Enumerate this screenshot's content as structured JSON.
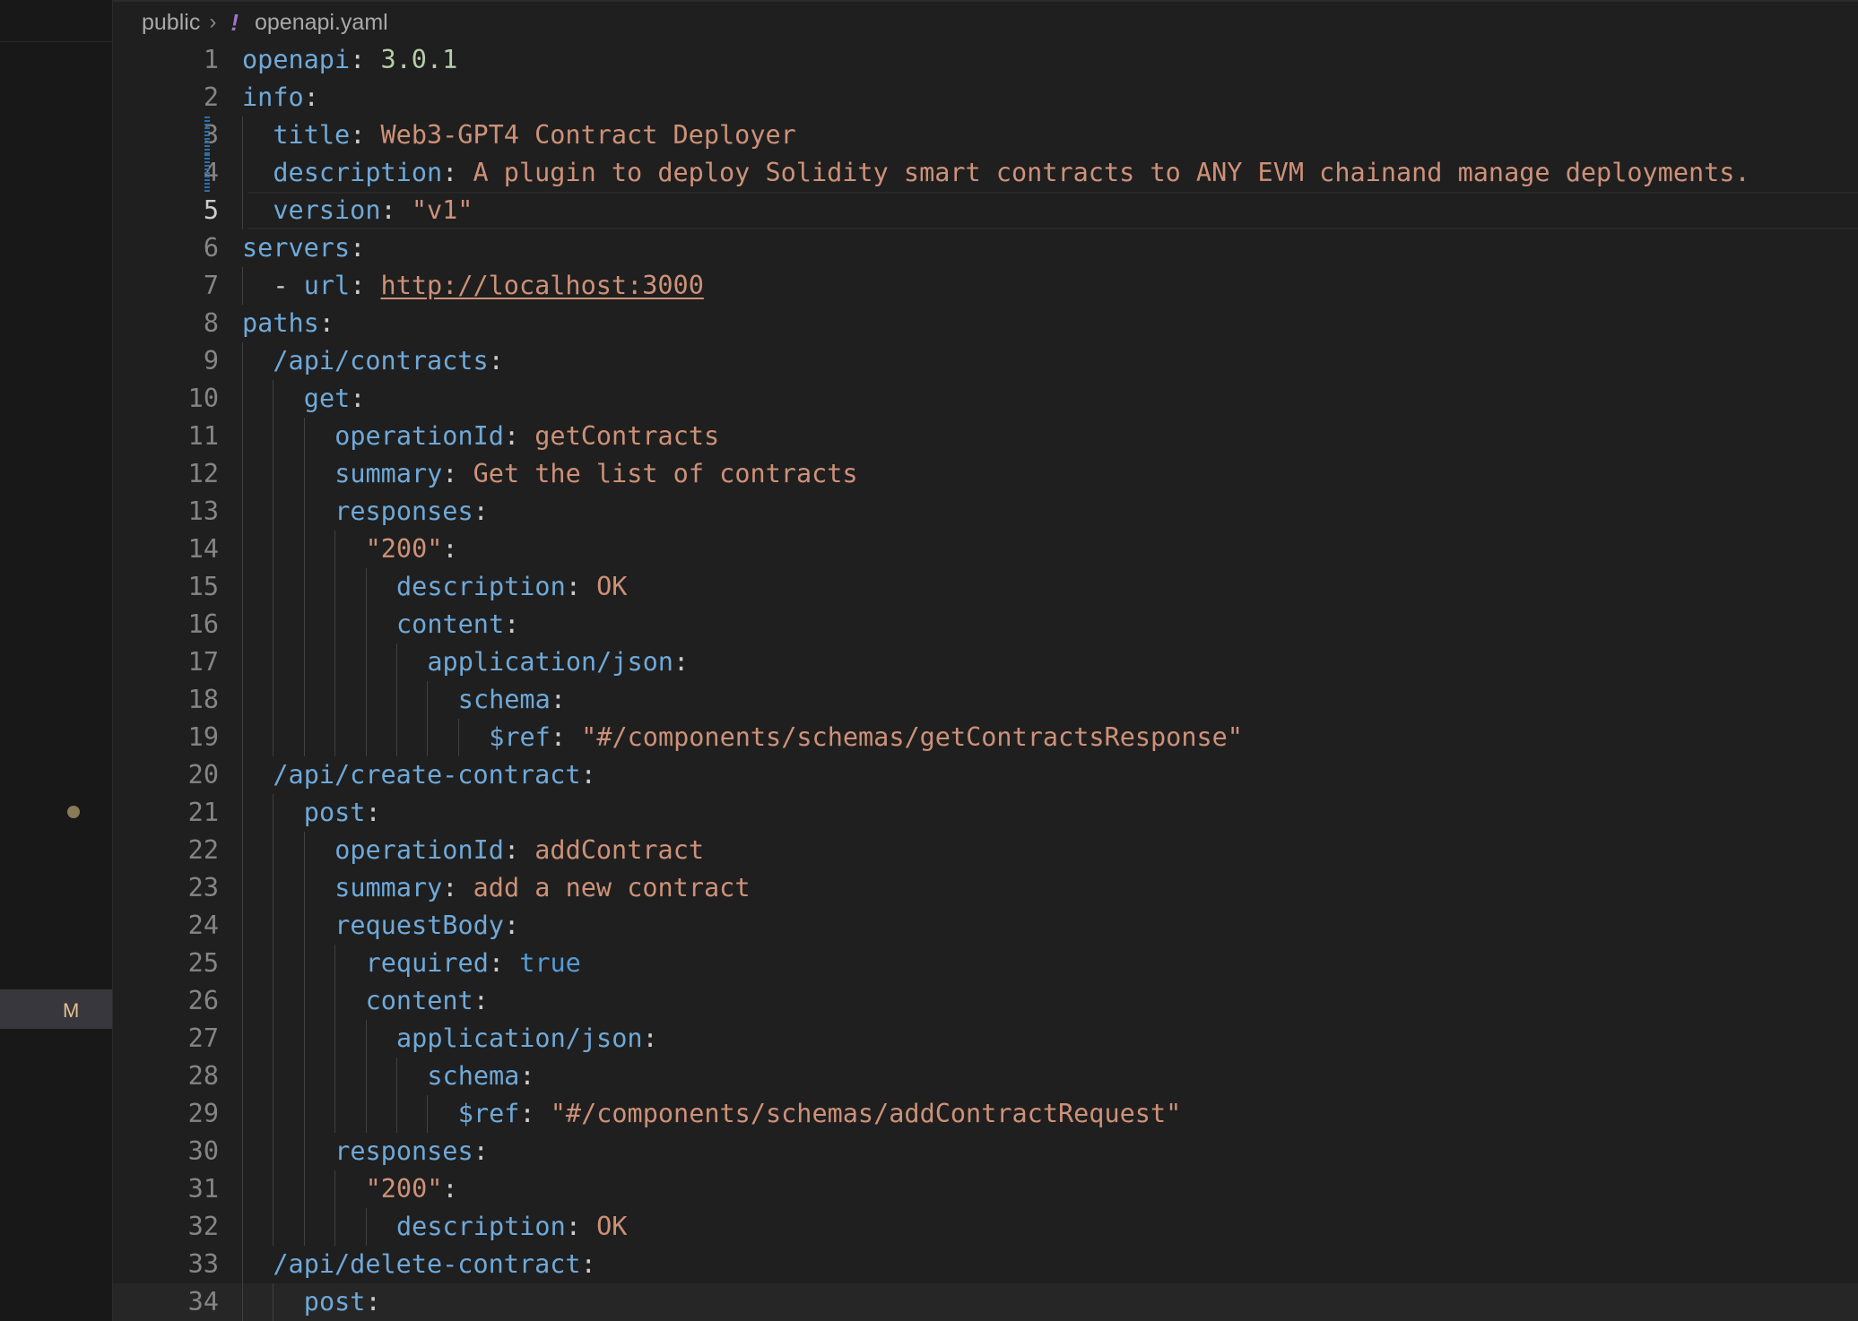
{
  "breadcrumb": {
    "folder": "public",
    "file_icon": "!",
    "file": "openapi.yaml"
  },
  "sidebar": {
    "modified_badge": "M"
  },
  "editor": {
    "active_line": 5,
    "lines": [
      {
        "n": "1",
        "indent": 0,
        "tokens": [
          [
            "key",
            "openapi"
          ],
          [
            "punc",
            ": "
          ],
          [
            "num",
            "3.0.1"
          ]
        ]
      },
      {
        "n": "2",
        "indent": 0,
        "tokens": [
          [
            "key",
            "info"
          ],
          [
            "punc",
            ":"
          ]
        ]
      },
      {
        "n": "3",
        "indent": 1,
        "changed": true,
        "tokens": [
          [
            "key",
            "title"
          ],
          [
            "punc",
            ": "
          ],
          [
            "str",
            "Web3-GPT4 Contract Deployer"
          ]
        ]
      },
      {
        "n": "4",
        "indent": 1,
        "changed": true,
        "tokens": [
          [
            "key",
            "description"
          ],
          [
            "punc",
            ": "
          ],
          [
            "str",
            "A plugin to deploy Solidity smart contracts to ANY EVM chainand manage deployments."
          ]
        ]
      },
      {
        "n": "5",
        "indent": 1,
        "tokens": [
          [
            "key",
            "version"
          ],
          [
            "punc",
            ": "
          ],
          [
            "str",
            "\"v1\""
          ]
        ]
      },
      {
        "n": "6",
        "indent": 0,
        "tokens": [
          [
            "key",
            "servers"
          ],
          [
            "punc",
            ":"
          ]
        ]
      },
      {
        "n": "7",
        "indent": 1,
        "tokens": [
          [
            "punc",
            "- "
          ],
          [
            "key",
            "url"
          ],
          [
            "punc",
            ": "
          ],
          [
            "url",
            "http://localhost:3000"
          ]
        ]
      },
      {
        "n": "8",
        "indent": 0,
        "tokens": [
          [
            "key",
            "paths"
          ],
          [
            "punc",
            ":"
          ]
        ]
      },
      {
        "n": "9",
        "indent": 1,
        "tokens": [
          [
            "key",
            "/api/contracts"
          ],
          [
            "punc",
            ":"
          ]
        ]
      },
      {
        "n": "10",
        "indent": 2,
        "tokens": [
          [
            "key",
            "get"
          ],
          [
            "punc",
            ":"
          ]
        ]
      },
      {
        "n": "11",
        "indent": 3,
        "tokens": [
          [
            "key",
            "operationId"
          ],
          [
            "punc",
            ": "
          ],
          [
            "str",
            "getContracts"
          ]
        ]
      },
      {
        "n": "12",
        "indent": 3,
        "tokens": [
          [
            "key",
            "summary"
          ],
          [
            "punc",
            ": "
          ],
          [
            "str",
            "Get the list of contracts"
          ]
        ]
      },
      {
        "n": "13",
        "indent": 3,
        "tokens": [
          [
            "key",
            "responses"
          ],
          [
            "punc",
            ":"
          ]
        ]
      },
      {
        "n": "14",
        "indent": 4,
        "tokens": [
          [
            "str",
            "\"200\""
          ],
          [
            "punc",
            ":"
          ]
        ]
      },
      {
        "n": "15",
        "indent": 5,
        "tokens": [
          [
            "key",
            "description"
          ],
          [
            "punc",
            ": "
          ],
          [
            "str",
            "OK"
          ]
        ]
      },
      {
        "n": "16",
        "indent": 5,
        "tokens": [
          [
            "key",
            "content"
          ],
          [
            "punc",
            ":"
          ]
        ]
      },
      {
        "n": "17",
        "indent": 6,
        "tokens": [
          [
            "key",
            "application/json"
          ],
          [
            "punc",
            ":"
          ]
        ]
      },
      {
        "n": "18",
        "indent": 7,
        "tokens": [
          [
            "key",
            "schema"
          ],
          [
            "punc",
            ":"
          ]
        ]
      },
      {
        "n": "19",
        "indent": 8,
        "tokens": [
          [
            "key",
            "$ref"
          ],
          [
            "punc",
            ": "
          ],
          [
            "str",
            "\"#/components/schemas/getContractsResponse\""
          ]
        ]
      },
      {
        "n": "20",
        "indent": 1,
        "tokens": [
          [
            "key",
            "/api/create-contract"
          ],
          [
            "punc",
            ":"
          ]
        ]
      },
      {
        "n": "21",
        "indent": 2,
        "tokens": [
          [
            "key",
            "post"
          ],
          [
            "punc",
            ":"
          ]
        ]
      },
      {
        "n": "22",
        "indent": 3,
        "tokens": [
          [
            "key",
            "operationId"
          ],
          [
            "punc",
            ": "
          ],
          [
            "str",
            "addContract"
          ]
        ]
      },
      {
        "n": "23",
        "indent": 3,
        "tokens": [
          [
            "key",
            "summary"
          ],
          [
            "punc",
            ": "
          ],
          [
            "str",
            "add a new contract"
          ]
        ]
      },
      {
        "n": "24",
        "indent": 3,
        "tokens": [
          [
            "key",
            "requestBody"
          ],
          [
            "punc",
            ":"
          ]
        ]
      },
      {
        "n": "25",
        "indent": 4,
        "tokens": [
          [
            "key",
            "required"
          ],
          [
            "punc",
            ": "
          ],
          [
            "bool",
            "true"
          ]
        ]
      },
      {
        "n": "26",
        "indent": 4,
        "tokens": [
          [
            "key",
            "content"
          ],
          [
            "punc",
            ":"
          ]
        ]
      },
      {
        "n": "27",
        "indent": 5,
        "tokens": [
          [
            "key",
            "application/json"
          ],
          [
            "punc",
            ":"
          ]
        ]
      },
      {
        "n": "28",
        "indent": 6,
        "tokens": [
          [
            "key",
            "schema"
          ],
          [
            "punc",
            ":"
          ]
        ]
      },
      {
        "n": "29",
        "indent": 7,
        "tokens": [
          [
            "key",
            "$ref"
          ],
          [
            "punc",
            ": "
          ],
          [
            "str",
            "\"#/components/schemas/addContractRequest\""
          ]
        ]
      },
      {
        "n": "30",
        "indent": 3,
        "tokens": [
          [
            "key",
            "responses"
          ],
          [
            "punc",
            ":"
          ]
        ]
      },
      {
        "n": "31",
        "indent": 4,
        "tokens": [
          [
            "str",
            "\"200\""
          ],
          [
            "punc",
            ":"
          ]
        ]
      },
      {
        "n": "32",
        "indent": 5,
        "tokens": [
          [
            "key",
            "description"
          ],
          [
            "punc",
            ": "
          ],
          [
            "str",
            "OK"
          ]
        ]
      },
      {
        "n": "33",
        "indent": 1,
        "tokens": [
          [
            "key",
            "/api/delete-contract"
          ],
          [
            "punc",
            ":"
          ]
        ]
      },
      {
        "n": "34",
        "indent": 2,
        "tokens": [
          [
            "key",
            "post"
          ],
          [
            "punc",
            ":"
          ]
        ]
      }
    ]
  }
}
